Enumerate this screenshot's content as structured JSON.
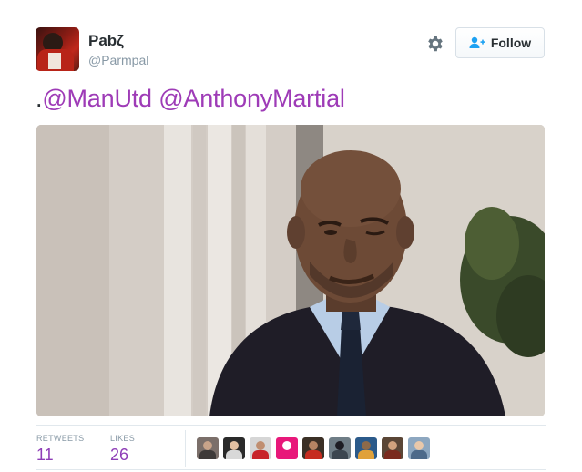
{
  "author": {
    "display_name": "Pabζ",
    "handle": "@Parmpal_"
  },
  "actions": {
    "follow_label": "Follow",
    "settings_icon": "gear-icon",
    "follow_icon": "add-user-icon"
  },
  "tweet": {
    "prefix": ".",
    "mentions": [
      "@ManUtd",
      "@AnthonyMartial"
    ]
  },
  "stats": {
    "retweets_label": "RETWEETS",
    "retweets_value": "11",
    "likes_label": "LIKES",
    "likes_value": "26"
  },
  "colors": {
    "mention": "#9e3bb7",
    "stat_value": "#8e3db7",
    "muted": "#8899a6",
    "text": "#292f33",
    "divider": "#e1e8ed"
  },
  "likers": [
    {
      "name": "liker-avatar-1",
      "bg": "#7b6f6a",
      "head": "#c9a48a",
      "body": "#3e3a39"
    },
    {
      "name": "liker-avatar-2",
      "bg": "#2a2a2a",
      "head": "#e2c0a2",
      "body": "#d8d8d8"
    },
    {
      "name": "liker-avatar-3",
      "bg": "#d6d6d6",
      "head": "#c08e70",
      "body": "#c8242a"
    },
    {
      "name": "liker-avatar-4",
      "bg": "#e8187a",
      "head": "#ffffff",
      "body": "#e8187a"
    },
    {
      "name": "liker-avatar-5",
      "bg": "#3b3026",
      "head": "#b58463",
      "body": "#c62c20"
    },
    {
      "name": "liker-avatar-6",
      "bg": "#6f7d86",
      "head": "#1d1d24",
      "body": "#3c4650"
    },
    {
      "name": "liker-avatar-7",
      "bg": "#2b5a8a",
      "head": "#8d6a4a",
      "body": "#e0a13a"
    },
    {
      "name": "liker-avatar-8",
      "bg": "#5a4636",
      "head": "#d1a27d",
      "body": "#7a2a1e"
    },
    {
      "name": "liker-avatar-9",
      "bg": "#8da7c0",
      "head": "#e9c8aa",
      "body": "#4d6a8a"
    }
  ]
}
